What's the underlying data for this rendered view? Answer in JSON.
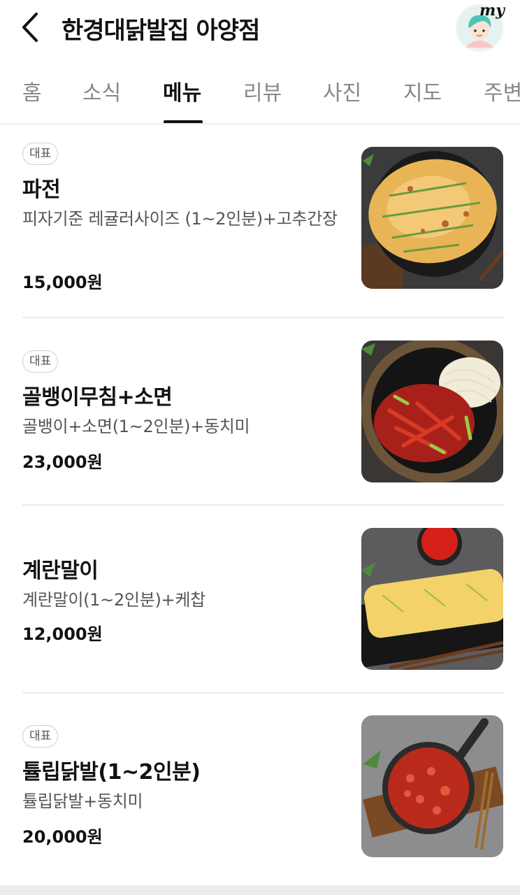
{
  "header": {
    "title": "한경대닭발집 아양점",
    "avatar_text": "my"
  },
  "tabs": [
    {
      "label": "홈"
    },
    {
      "label": "소식"
    },
    {
      "label": "메뉴"
    },
    {
      "label": "리뷰"
    },
    {
      "label": "사진"
    },
    {
      "label": "지도"
    },
    {
      "label": "주변"
    }
  ],
  "active_tab": "메뉴",
  "menu": [
    {
      "badge": "대표",
      "name": "파전",
      "desc": "피자기준 레귤러사이즈 (1~2인분)+고추간장",
      "price": "15,000원",
      "image_icon": "pajeon-photo"
    },
    {
      "badge": "대표",
      "name": "골뱅이무침+소면",
      "desc": "골뱅이+소면(1~2인분)+동치미",
      "price": "23,000원",
      "image_icon": "golbaengi-photo"
    },
    {
      "badge": "",
      "name": "계란말이",
      "desc": "계란말이(1~2인분)+케찹",
      "price": "12,000원",
      "image_icon": "egg-roll-photo"
    },
    {
      "badge": "대표",
      "name": "튤립닭발(1~2인분)",
      "desc": "튤립닭발+동치미",
      "price": "20,000원",
      "image_icon": "chicken-feet-photo"
    }
  ]
}
